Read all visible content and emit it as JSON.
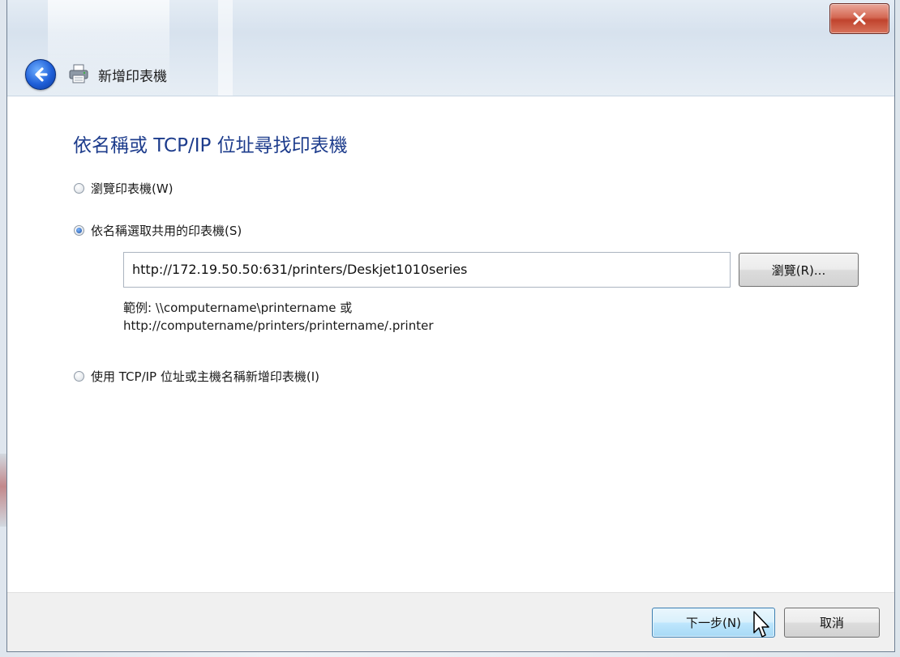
{
  "window": {
    "title": "新增印表機",
    "close_icon": "close-x-icon",
    "back_icon": "back-arrow-icon",
    "printer_icon": "printer-icon"
  },
  "page": {
    "heading": "依名稱或 TCP/IP 位址尋找印表機"
  },
  "options": [
    {
      "label": "瀏覽印表機(W)",
      "checked": false
    },
    {
      "label": "依名稱選取共用的印表機(S)",
      "checked": true
    },
    {
      "label": "使用 TCP/IP 位址或主機名稱新增印表機(I)",
      "checked": false
    }
  ],
  "shared_printer": {
    "value": "http://172.19.50.50:631/printers/Deskjet1010series",
    "browse_label": "瀏覽(R)...",
    "example_line1": "範例: \\\\computername\\printername 或",
    "example_line2": "http://computername/printers/printername/.printer"
  },
  "footer": {
    "next_label": "下一步(N)",
    "cancel_label": "取消"
  },
  "colors": {
    "heading": "#1d3c8c",
    "close_button": "#c0432d",
    "next_button_border": "#3c7fb1"
  }
}
